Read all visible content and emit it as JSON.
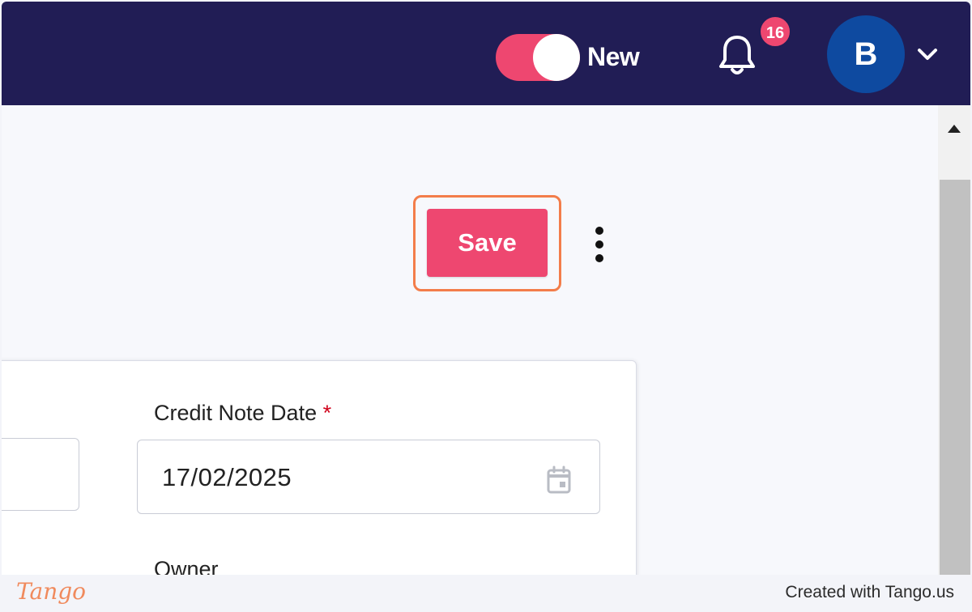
{
  "header": {
    "toggle_label": "New",
    "notification_count": "16",
    "avatar_initial": "B"
  },
  "toolbar": {
    "save_label": "Save"
  },
  "form": {
    "date_label": "Credit Note Date",
    "required_marker": "*",
    "date_value": "17/02/2025",
    "owner_label": "Owner"
  },
  "footer": {
    "logo_text": "Tango",
    "credit_text": "Created with Tango.us"
  },
  "colors": {
    "topbar": "#211d55",
    "accent": "#ee4770",
    "highlight": "#f37d4a",
    "avatar": "#0e4aa0"
  },
  "toggle_state": "on"
}
